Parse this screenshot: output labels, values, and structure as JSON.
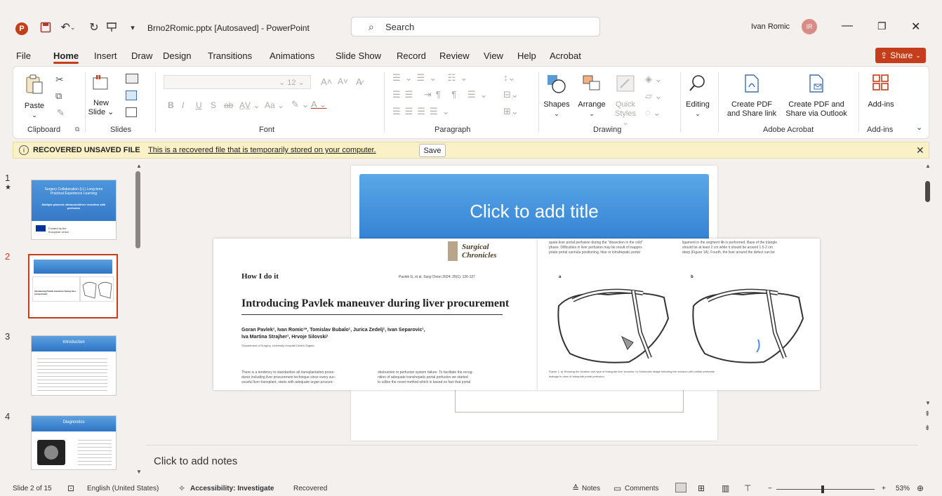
{
  "window": {
    "doc_title": "Brno2Romic.pptx [Autosaved] - PowerPoint",
    "search_placeholder": "Search",
    "user_name": "Ivan Romic",
    "user_initials": "IR"
  },
  "menu": {
    "tabs": [
      "File",
      "Home",
      "Insert",
      "Draw",
      "Design",
      "Transitions",
      "Animations",
      "Slide Show",
      "Record",
      "Review",
      "View",
      "Help",
      "Acrobat"
    ],
    "share_label": "Share"
  },
  "ribbon": {
    "clipboard": {
      "paste": "Paste",
      "label": "Clipboard"
    },
    "slides": {
      "new_slide_1": "New",
      "new_slide_2": "Slide",
      "label": "Slides"
    },
    "font": {
      "size": "12",
      "label": "Font"
    },
    "paragraph": {
      "label": "Paragraph"
    },
    "drawing": {
      "shapes": "Shapes",
      "arrange": "Arrange",
      "quick_styles_1": "Quick",
      "quick_styles_2": "Styles",
      "label": "Drawing"
    },
    "editing": {
      "label": "Editing"
    },
    "acrobat": {
      "create_pdf_1": "Create PDF",
      "create_pdf_2": "and Share link",
      "outlook_1": "Create PDF and",
      "outlook_2": "Share via Outlook",
      "label": "Adobe Acrobat"
    },
    "addins": {
      "addins": "Add-ins",
      "label": "Add-ins"
    }
  },
  "banner": {
    "title": "RECOVERED UNSAVED FILE",
    "message": "This is a recovered file that is temporarily stored on your computer.",
    "save_label": "Save"
  },
  "thumbnails": [
    {
      "num": "1",
      "marker": "★",
      "title": "Surgery Collaboration (LL) Long-term Practical Experience Learning",
      "subtitle": "Multiple planned ultrasound/liver resection with perfusion",
      "footer": "Funded by the European Union"
    },
    {
      "num": "2",
      "title": "Introducing Pavlek maneuver during liver procurement"
    },
    {
      "num": "3",
      "title": "Introduction"
    },
    {
      "num": "4",
      "title": "Diagnostics"
    }
  ],
  "slide": {
    "title_placeholder": "Click to add title",
    "notes_placeholder": "Click to add notes"
  },
  "paper": {
    "journal": "Surgical Chronicles",
    "section": "How I do it",
    "citation": "Pavlek G, et al. Surg Chron 2024; 29(1): 126-127",
    "title": "Introducing Pavlek maneuver during liver procurement",
    "authors_1": "Goran Pavlek¹, Ivan Romic¹*, Tomislav Bubalo¹, Jurica Zedelj¹, Ivan Separovic¹,",
    "authors_2": "Iva Martina Strajher¹, Hrvoje Silovski¹",
    "affiliation": "¹Department of Surgery, University Hospital Centre Zagreb",
    "body_l1": "There is a tendency to standardize all transplantation proce-",
    "body_l2": "dures including liver procurement technique since every suc-",
    "body_l3": "cessful liver transplant, starts with adequate organ procure-",
    "body_r1": "obstruction or perfusion system failure. To facilitate the recog-",
    "body_r2": "nition of adequate transhepatic portal perfusion we started",
    "body_r3": "to utilize the novel method which is based on fact that portal",
    "right_col_1": "quate liver portal perfusion during the \"dissection in the cold\"",
    "right_col_2": "phase. Difficulties in liver perfusion may be result of inappro-",
    "right_col_3": "priate portal cannula positioning, hilar or intrahepatic portal",
    "right_col_4": "ligament in the segment 4b is performed. Base of the triangle",
    "right_col_5": "should be at least 2 cm while it should be around 1.5-2 cm",
    "right_col_6": "deep (Figure 1A). Fourth, the liver around the defect can be",
    "fig_a": "a",
    "fig_b": "b",
    "fig_caption_1": "Figure 1. a) Showing the location and type of triangular liver excision; b) Schematic image following the excision with visible perfusate",
    "fig_caption_2": "leakage in case of adequate portal perfusion."
  },
  "status": {
    "slide_info": "Slide 2 of 15",
    "language": "English (United States)",
    "accessibility": "Accessibility: Investigate",
    "recovered": "Recovered",
    "notes": "Notes",
    "comments": "Comments",
    "zoom": "53%"
  },
  "colors": {
    "accent": "#c43e1c",
    "banner_bg": "#fbf1c6",
    "slide_blue": "#2f7cd0"
  }
}
